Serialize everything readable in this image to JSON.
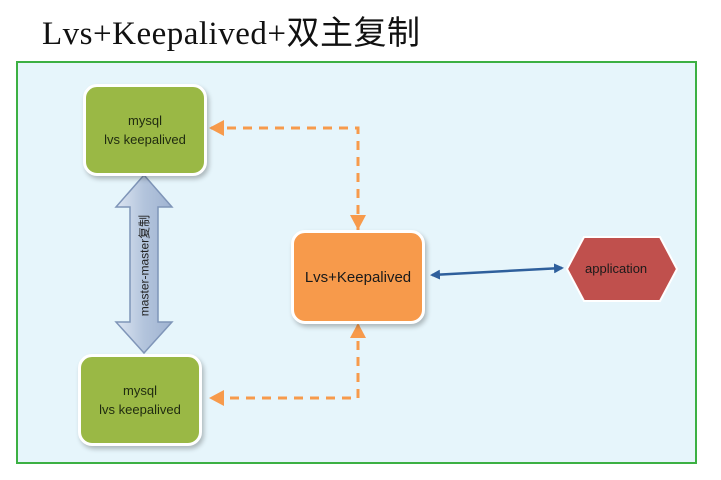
{
  "slide": {
    "title": "Lvs+Keepalived+双主复制"
  },
  "diagram": {
    "nodes": {
      "mysql_top": {
        "line1": "mysql",
        "line2": "lvs keepalived"
      },
      "mysql_bottom": {
        "line1": "mysql",
        "line2": "lvs keepalived"
      },
      "lvs": {
        "label": "Lvs+Keepalived"
      },
      "application": {
        "label": "application"
      }
    },
    "replication_label": "master-master复制"
  },
  "colors": {
    "frame_border": "#3cb043",
    "frame_fill": "#e6f5fb",
    "mysql_node": "#9ab845",
    "lvs_node": "#f79a4b",
    "application_node": "#c0504d",
    "dashed_arrow": "#f79a4b",
    "link_arrow": "#2e5f9c",
    "replication_arrow": "#b7c8e0"
  }
}
